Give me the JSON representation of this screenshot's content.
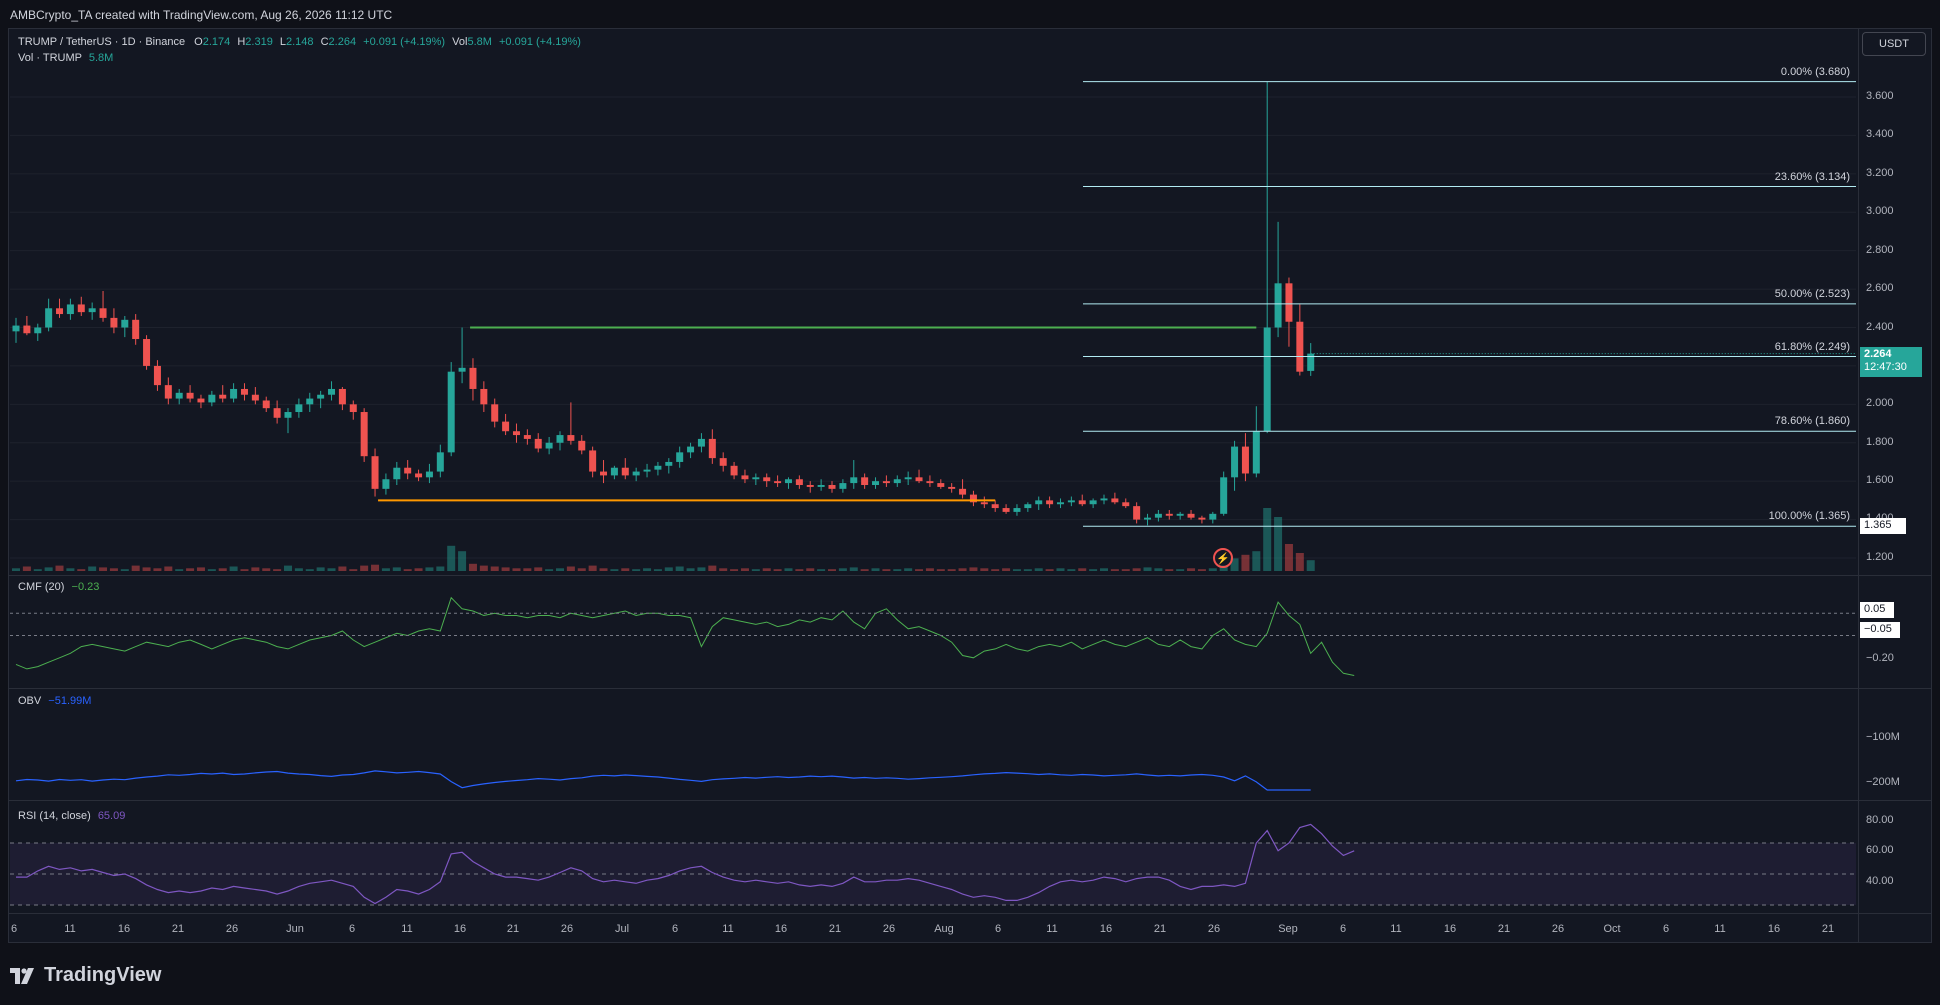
{
  "header": {
    "attribution": "AMBCrypto_TA created with TradingView.com, Aug 26, 2026 11:12 UTC"
  },
  "symbol": {
    "pair": "TRUMP / TetherUS · 1D · Binance",
    "o_label": "O",
    "o": "2.174",
    "h_label": "H",
    "h": "2.319",
    "l_label": "L",
    "l": "2.148",
    "c_label": "C",
    "c": "2.264",
    "change": "+0.091 (+4.19%)",
    "vol_label": "Vol",
    "vol": "5.8M",
    "vol_change": "+0.091 (+4.19%)",
    "vol_series_label": "Vol · TRUMP",
    "vol_series_value": "5.8M"
  },
  "currency_button": "USDT",
  "price_axis": {
    "ticks": [
      "3.600",
      "3.400",
      "3.200",
      "3.000",
      "2.800",
      "2.600",
      "2.400",
      "2.000",
      "1.800",
      "1.600",
      "1.200"
    ],
    "current_price": "2.264",
    "countdown": "12:47:30",
    "level_badge": "1.365",
    "partial_tick": "1.400"
  },
  "fib_levels": [
    {
      "label": "0.00% (3.680)",
      "value": 3.68
    },
    {
      "label": "23.60% (3.134)",
      "value": 3.134
    },
    {
      "label": "50.00% (2.523)",
      "value": 2.523
    },
    {
      "label": "61.80% (2.249)",
      "value": 2.249
    },
    {
      "label": "78.60% (1.860)",
      "value": 1.86
    },
    {
      "label": "100.00% (1.365)",
      "value": 1.365
    }
  ],
  "indicators": {
    "cmf": {
      "label": "CMF (20)",
      "value": "−0.23",
      "axis": [
        "0.05",
        "−0.05",
        "−0.20"
      ]
    },
    "obv": {
      "label": "OBV",
      "value": "−51.99M",
      "axis": [
        "−100M",
        "−200M"
      ]
    },
    "rsi": {
      "label": "RSI (14, close)",
      "value": "65.09",
      "axis": [
        "80.00",
        "60.00",
        "40.00"
      ]
    }
  },
  "time_axis": [
    "6",
    "11",
    "16",
    "21",
    "26",
    "Jun",
    "6",
    "11",
    "16",
    "21",
    "26",
    "Jul",
    "6",
    "11",
    "16",
    "21",
    "26",
    "Aug",
    "6",
    "11",
    "16",
    "21",
    "26",
    "Sep",
    "6",
    "11",
    "16",
    "21",
    "26",
    "Oct",
    "6",
    "11",
    "16",
    "21"
  ],
  "branding": {
    "logo_text": "TradingView"
  },
  "colors": {
    "up": "#26a69a",
    "down": "#ef5350",
    "background": "#131722",
    "resistance": "#4caf50",
    "support": "#ff9800",
    "obv": "#2962ff",
    "rsi": "#7e57c2"
  },
  "chart_data": {
    "type": "candlestick",
    "symbol": "TRUMP / TetherUS",
    "interval": "1D",
    "y_axis": {
      "min": 1.2,
      "max": 3.6
    },
    "last": {
      "open": 2.174,
      "high": 2.319,
      "low": 2.148,
      "close": 2.264
    },
    "candles_ohlc": [
      [
        2.38,
        2.45,
        2.32,
        2.41
      ],
      [
        2.41,
        2.46,
        2.36,
        2.37
      ],
      [
        2.37,
        2.42,
        2.33,
        2.4
      ],
      [
        2.4,
        2.55,
        2.38,
        2.5
      ],
      [
        2.5,
        2.55,
        2.45,
        2.47
      ],
      [
        2.47,
        2.55,
        2.44,
        2.52
      ],
      [
        2.52,
        2.56,
        2.46,
        2.48
      ],
      [
        2.48,
        2.53,
        2.44,
        2.5
      ],
      [
        2.5,
        2.59,
        2.43,
        2.45
      ],
      [
        2.45,
        2.5,
        2.37,
        2.4
      ],
      [
        2.4,
        2.46,
        2.35,
        2.44
      ],
      [
        2.44,
        2.47,
        2.31,
        2.34
      ],
      [
        2.34,
        2.36,
        2.18,
        2.2
      ],
      [
        2.2,
        2.23,
        2.07,
        2.1
      ],
      [
        2.1,
        2.14,
        2.0,
        2.03
      ],
      [
        2.03,
        2.08,
        2.0,
        2.06
      ],
      [
        2.06,
        2.1,
        2.01,
        2.03
      ],
      [
        2.03,
        2.05,
        1.98,
        2.01
      ],
      [
        2.01,
        2.07,
        1.99,
        2.05
      ],
      [
        2.05,
        2.1,
        2.01,
        2.03
      ],
      [
        2.03,
        2.11,
        2.01,
        2.08
      ],
      [
        2.08,
        2.11,
        2.02,
        2.05
      ],
      [
        2.05,
        2.09,
        2.0,
        2.02
      ],
      [
        2.02,
        2.04,
        1.96,
        1.98
      ],
      [
        1.98,
        2.02,
        1.9,
        1.93
      ],
      [
        1.93,
        1.98,
        1.85,
        1.96
      ],
      [
        1.96,
        2.03,
        1.93,
        2.0
      ],
      [
        2.0,
        2.06,
        1.96,
        2.03
      ],
      [
        2.03,
        2.07,
        1.98,
        2.05
      ],
      [
        2.05,
        2.12,
        2.02,
        2.08
      ],
      [
        2.08,
        2.09,
        1.97,
        2.0
      ],
      [
        2.0,
        2.02,
        1.92,
        1.96
      ],
      [
        1.96,
        1.98,
        1.7,
        1.73
      ],
      [
        1.73,
        1.77,
        1.52,
        1.56
      ],
      [
        1.56,
        1.64,
        1.53,
        1.61
      ],
      [
        1.61,
        1.7,
        1.58,
        1.67
      ],
      [
        1.67,
        1.71,
        1.61,
        1.64
      ],
      [
        1.64,
        1.66,
        1.6,
        1.62
      ],
      [
        1.62,
        1.69,
        1.59,
        1.65
      ],
      [
        1.65,
        1.79,
        1.62,
        1.75
      ],
      [
        1.75,
        2.22,
        1.73,
        2.17
      ],
      [
        2.17,
        2.4,
        2.11,
        2.19
      ],
      [
        2.19,
        2.24,
        2.02,
        2.08
      ],
      [
        2.08,
        2.12,
        1.96,
        2.0
      ],
      [
        2.0,
        2.03,
        1.88,
        1.91
      ],
      [
        1.91,
        1.95,
        1.84,
        1.86
      ],
      [
        1.86,
        1.9,
        1.8,
        1.84
      ],
      [
        1.84,
        1.87,
        1.79,
        1.82
      ],
      [
        1.82,
        1.85,
        1.75,
        1.77
      ],
      [
        1.77,
        1.83,
        1.74,
        1.8
      ],
      [
        1.8,
        1.86,
        1.76,
        1.84
      ],
      [
        1.84,
        2.01,
        1.79,
        1.81
      ],
      [
        1.81,
        1.84,
        1.74,
        1.76
      ],
      [
        1.76,
        1.78,
        1.62,
        1.65
      ],
      [
        1.65,
        1.71,
        1.59,
        1.63
      ],
      [
        1.63,
        1.68,
        1.61,
        1.67
      ],
      [
        1.67,
        1.72,
        1.61,
        1.63
      ],
      [
        1.63,
        1.67,
        1.6,
        1.65
      ],
      [
        1.65,
        1.69,
        1.62,
        1.66
      ],
      [
        1.66,
        1.7,
        1.63,
        1.68
      ],
      [
        1.68,
        1.72,
        1.64,
        1.7
      ],
      [
        1.7,
        1.78,
        1.67,
        1.75
      ],
      [
        1.75,
        1.8,
        1.72,
        1.78
      ],
      [
        1.78,
        1.85,
        1.75,
        1.82
      ],
      [
        1.82,
        1.87,
        1.69,
        1.72
      ],
      [
        1.72,
        1.75,
        1.65,
        1.68
      ],
      [
        1.68,
        1.7,
        1.61,
        1.63
      ],
      [
        1.63,
        1.66,
        1.59,
        1.61
      ],
      [
        1.61,
        1.64,
        1.58,
        1.62
      ],
      [
        1.62,
        1.64,
        1.57,
        1.6
      ],
      [
        1.6,
        1.63,
        1.57,
        1.59
      ],
      [
        1.59,
        1.62,
        1.56,
        1.61
      ],
      [
        1.61,
        1.63,
        1.56,
        1.58
      ],
      [
        1.58,
        1.6,
        1.54,
        1.57
      ],
      [
        1.57,
        1.61,
        1.55,
        1.58
      ],
      [
        1.58,
        1.6,
        1.54,
        1.56
      ],
      [
        1.56,
        1.61,
        1.54,
        1.59
      ],
      [
        1.59,
        1.71,
        1.56,
        1.62
      ],
      [
        1.62,
        1.64,
        1.56,
        1.58
      ],
      [
        1.58,
        1.62,
        1.56,
        1.6
      ],
      [
        1.6,
        1.63,
        1.57,
        1.59
      ],
      [
        1.59,
        1.63,
        1.57,
        1.61
      ],
      [
        1.61,
        1.65,
        1.58,
        1.62
      ],
      [
        1.62,
        1.66,
        1.59,
        1.6
      ],
      [
        1.6,
        1.63,
        1.57,
        1.59
      ],
      [
        1.59,
        1.61,
        1.56,
        1.57
      ],
      [
        1.57,
        1.59,
        1.54,
        1.56
      ],
      [
        1.56,
        1.61,
        1.51,
        1.53
      ],
      [
        1.53,
        1.55,
        1.47,
        1.49
      ],
      [
        1.49,
        1.52,
        1.46,
        1.48
      ],
      [
        1.48,
        1.5,
        1.44,
        1.46
      ],
      [
        1.46,
        1.48,
        1.43,
        1.44
      ],
      [
        1.44,
        1.48,
        1.42,
        1.46
      ],
      [
        1.46,
        1.49,
        1.44,
        1.48
      ],
      [
        1.48,
        1.52,
        1.45,
        1.5
      ],
      [
        1.5,
        1.52,
        1.46,
        1.48
      ],
      [
        1.48,
        1.51,
        1.46,
        1.49
      ],
      [
        1.49,
        1.52,
        1.47,
        1.5
      ],
      [
        1.5,
        1.53,
        1.47,
        1.48
      ],
      [
        1.48,
        1.51,
        1.46,
        1.5
      ],
      [
        1.5,
        1.53,
        1.48,
        1.51
      ],
      [
        1.51,
        1.54,
        1.48,
        1.49
      ],
      [
        1.49,
        1.51,
        1.46,
        1.47
      ],
      [
        1.47,
        1.49,
        1.38,
        1.4
      ],
      [
        1.4,
        1.43,
        1.37,
        1.41
      ],
      [
        1.41,
        1.45,
        1.39,
        1.43
      ],
      [
        1.43,
        1.45,
        1.4,
        1.42
      ],
      [
        1.42,
        1.44,
        1.4,
        1.43
      ],
      [
        1.43,
        1.45,
        1.4,
        1.41
      ],
      [
        1.41,
        1.42,
        1.38,
        1.4
      ],
      [
        1.4,
        1.44,
        1.38,
        1.43
      ],
      [
        1.43,
        1.65,
        1.42,
        1.62
      ],
      [
        1.62,
        1.81,
        1.55,
        1.78
      ],
      [
        1.78,
        1.85,
        1.6,
        1.64
      ],
      [
        1.64,
        1.99,
        1.62,
        1.86
      ],
      [
        1.86,
        3.68,
        1.85,
        2.4
      ],
      [
        2.4,
        2.95,
        2.35,
        2.63
      ],
      [
        2.63,
        2.66,
        2.3,
        2.43
      ],
      [
        2.43,
        2.52,
        2.15,
        2.17
      ],
      [
        2.174,
        2.319,
        2.148,
        2.264
      ]
    ],
    "fib_levels": [
      3.68,
      3.134,
      2.523,
      2.249,
      1.86,
      1.365
    ],
    "resistance_line": 2.4,
    "support_line": 1.5,
    "cmf": {
      "name": "CMF (20)",
      "last": -0.23,
      "ylim": [
        -0.3,
        0.2
      ]
    },
    "obv": {
      "name": "OBV",
      "last": "-51.99M"
    },
    "rsi": {
      "name": "RSI (14, close)",
      "last": 65.09,
      "ylim": [
        30,
        90
      ],
      "bands": [
        30,
        70
      ]
    }
  }
}
